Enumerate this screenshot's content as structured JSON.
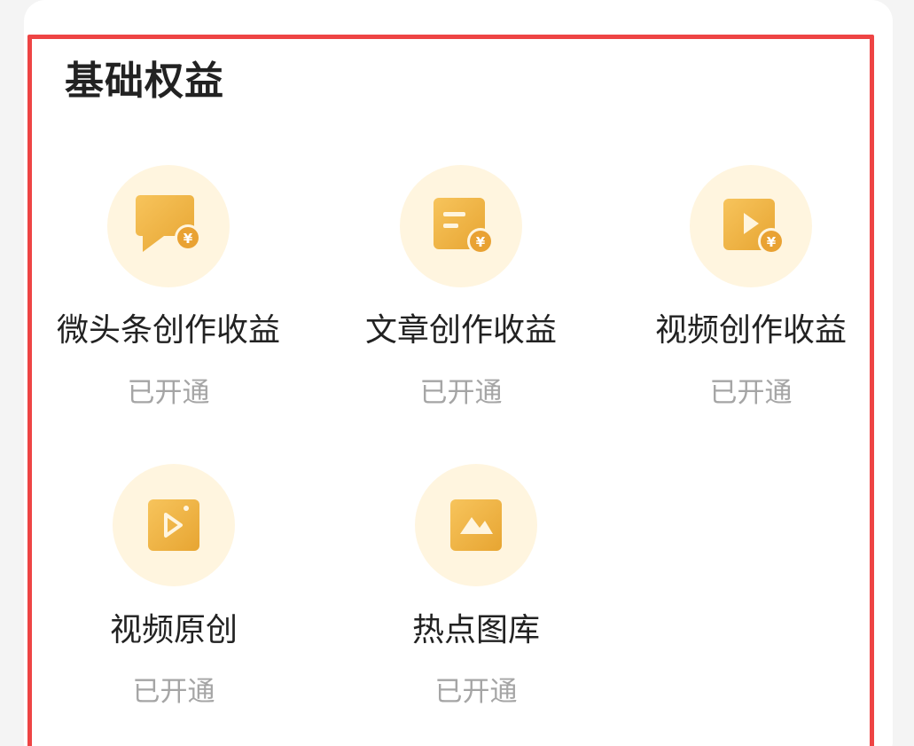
{
  "section": {
    "title": "基础权益"
  },
  "benefits": [
    {
      "label": "微头条创作收益",
      "status": "已开通",
      "icon": "micro-headline-revenue-icon"
    },
    {
      "label": "文章创作收益",
      "status": "已开通",
      "icon": "article-revenue-icon"
    },
    {
      "label": "视频创作收益",
      "status": "已开通",
      "icon": "video-revenue-icon"
    },
    {
      "label": "视频原创",
      "status": "已开通",
      "icon": "video-original-icon"
    },
    {
      "label": "热点图库",
      "status": "已开通",
      "icon": "hotspot-gallery-icon"
    }
  ],
  "colors": {
    "accent": "#f4b43f",
    "accent_light": "#fff5df",
    "highlight": "#ee4444",
    "text_primary": "#222222",
    "text_secondary": "#a5a5a5"
  }
}
